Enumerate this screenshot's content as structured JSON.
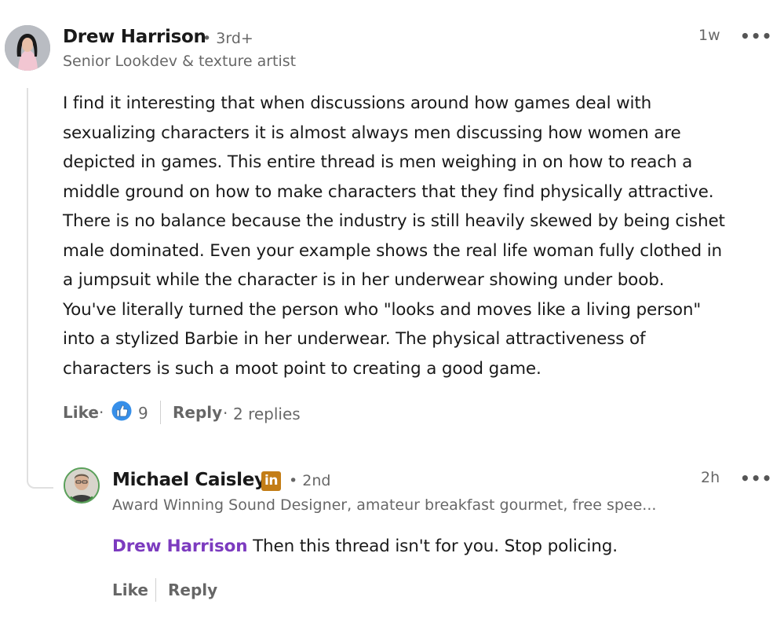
{
  "comment": {
    "author": "Drew Harrison",
    "degree": "• 3rd+",
    "headline": "Senior Lookdev & texture artist",
    "time": "1w",
    "more": "•••",
    "lines": [
      "I find it interesting that when discussions around how games deal with",
      "sexualizing characters it is almost always men discussing how women are",
      "depicted in games. This entire thread is men weighing in on how to reach a",
      "middle ground on how to make characters that they find physically attractive.",
      "There is no balance because the industry is still heavily skewed by being cishet",
      "male dominated. Even your example shows the real life woman fully clothed in",
      "a jumpsuit while the character is in her underwear showing under boob.",
      "You've literally turned the person who \"looks and moves like a living person\"",
      "into a stylized Barbie in her underwear. The physical attractiveness of",
      "characters is such a moot point to creating a good game."
    ],
    "like_label": "Like",
    "dot": "·",
    "reaction_icon": "like-reaction-icon",
    "reaction_count": "9",
    "reply_label": "Reply",
    "replies_text": "2 replies"
  },
  "reply": {
    "author": "Michael Caisley",
    "badge_icon": "linkedin-badge-icon",
    "badge_text": "in",
    "degree": "• 2nd",
    "headline": "Award Winning Sound Designer, amateur breakfast gourmet, free spee...",
    "time": "2h",
    "more": "•••",
    "mention": "Drew Harrison",
    "text": " Then this thread isn't for you. Stop policing.",
    "like_label": "Like",
    "reply_label": "Reply"
  },
  "colors": {
    "mention": "#7c3bbf",
    "reaction_blue": "#378fe9",
    "linkedin_badge": "#c37d16"
  }
}
